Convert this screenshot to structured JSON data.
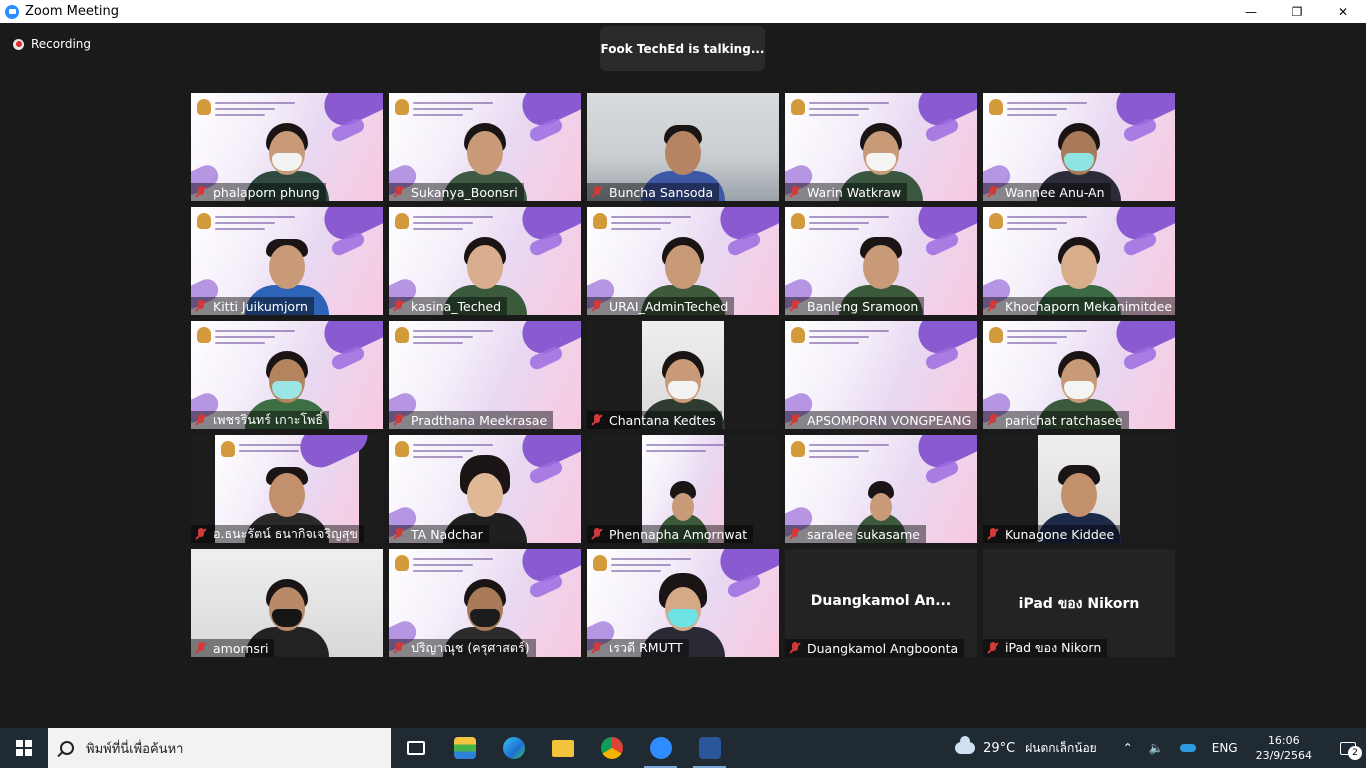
{
  "window": {
    "title": "Zoom Meeting",
    "minimize": "—",
    "maximize": "❐",
    "close": "✕"
  },
  "meeting": {
    "recording_label": "Recording",
    "talking_banner": "Fook TechEd is talking..."
  },
  "participants": [
    {
      "name": "phalaporn phung",
      "muted": true
    },
    {
      "name": "Sukanya_Boonsri",
      "muted": true
    },
    {
      "name": "Buncha Sansoda",
      "muted": true
    },
    {
      "name": "Warin Watkraw",
      "muted": true
    },
    {
      "name": "Wannee Anu-An",
      "muted": true
    },
    {
      "name": "Kitti Juikumjorn",
      "muted": true
    },
    {
      "name": "kasina_Teched",
      "muted": true
    },
    {
      "name": "URAI_AdminTeched",
      "muted": true
    },
    {
      "name": "Banleng Sramoon",
      "muted": true
    },
    {
      "name": "Khochaporn Mekanimitdee",
      "muted": true
    },
    {
      "name": "เพชรรินทร์ เกาะโพธิ์",
      "muted": true
    },
    {
      "name": "Pradthana Meekrasae",
      "muted": true
    },
    {
      "name": "Chantana Kedtes",
      "muted": true
    },
    {
      "name": "APSOMPORN VONGPEANG",
      "muted": true
    },
    {
      "name": "parichat ratchasee",
      "muted": true
    },
    {
      "name": "อ.ธนะรัตน์ ธนากิจเจริญสุข",
      "muted": true
    },
    {
      "name": "TA Nadchar",
      "muted": true
    },
    {
      "name": "Phennapha Amornwat",
      "muted": true
    },
    {
      "name": "saralee sukasame",
      "muted": true
    },
    {
      "name": "Kunagone Kiddee",
      "muted": true
    },
    {
      "name": "amornsri",
      "muted": true
    },
    {
      "name": "ปริญาณุช (ครุศาสตร์)",
      "muted": true
    },
    {
      "name": "เรวดี RMUTT",
      "muted": true
    },
    {
      "name": "Duangkamol Angboonta",
      "display": "Duangkamol  An...",
      "muted": true
    },
    {
      "name": "iPad ของ Nikorn",
      "display": "iPad ของ Nikorn",
      "muted": true
    }
  ],
  "taskbar": {
    "search_placeholder": "พิมพ์ที่นี่เพื่อค้นหา",
    "temperature": "29°C",
    "weather": "ฝนตกเล็กน้อย",
    "language": "ENG",
    "time": "16:06",
    "date": "23/9/2564",
    "notification_count": "2",
    "up_arrow": "⌃",
    "speaker": "🔈"
  }
}
